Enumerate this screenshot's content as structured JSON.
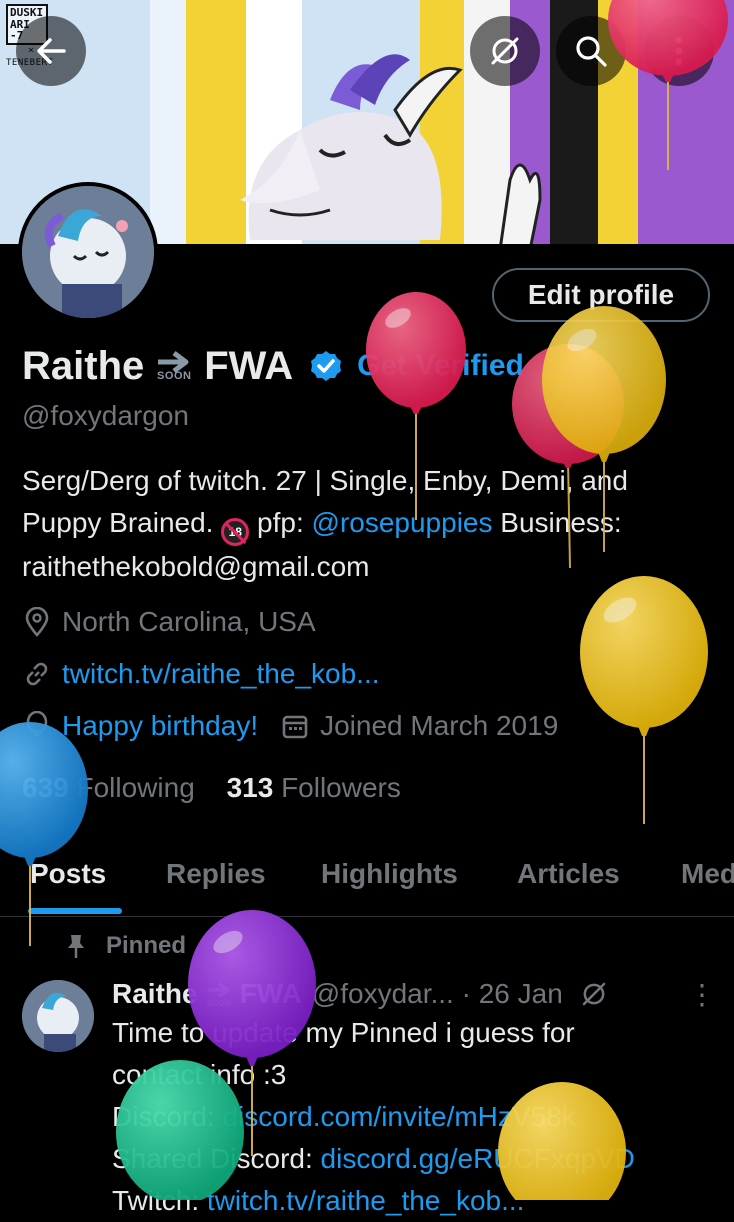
{
  "banner": {
    "artist_tag_lines": [
      "DUSKI",
      "ARI",
      "-7"
    ],
    "artist_collab": "TENEBERT",
    "back_icon": "arrow-left-icon",
    "top_icons": [
      "grok-slash-icon",
      "search-icon",
      "more-vertical-icon"
    ]
  },
  "profile": {
    "edit_label": "Edit profile",
    "name_left": "Raithe",
    "soon_label": "SOON",
    "name_right": "FWA",
    "get_verified": "Get Verified",
    "handle": "@foxydargon",
    "bio_line1": "Serg/Derg of twitch. 27 | Single, Enby, Demi, and",
    "bio_line2_prefix": "Puppy Brained.",
    "bio_no18": "18",
    "bio_line2_mid": "pfp:",
    "bio_mention": "@rosepuppies",
    "bio_line2_suffix": "Business:",
    "bio_line3": "raithethekobold@gmail.com",
    "location": "North Carolina, USA",
    "website": "twitch.tv/raithe_the_kob...",
    "birthday": "Happy birthday!",
    "joined": "Joined March 2019",
    "following_count": "639",
    "following_label": "Following",
    "followers_count": "313",
    "followers_label": "Followers"
  },
  "tabs": [
    "Posts",
    "Replies",
    "Highlights",
    "Articles",
    "Med"
  ],
  "pinned": {
    "label": "Pinned",
    "name_left": "Raithe",
    "soon_label": "SOON",
    "name_right": "FWA",
    "handle_time": "@foxydar... · 26 Jan",
    "more": "⋮",
    "line1": "Time to update my Pinned i guess for",
    "line2": "contact info :3",
    "line3_prefix": "Discord:",
    "line3_link": "discord.com/invite/mHzV58k",
    "line4_prefix": "Shared Discord:",
    "line4_link": "discord.gg/eRUCFxqpVD",
    "line5_prefix": "Twitch:",
    "line5_link": "twitch.tv/raithe_the_kob..."
  },
  "colors": {
    "accent": "#1d9bf0",
    "text": "#e7e9ea",
    "muted": "#71767b",
    "balloon_red": "#e0245e",
    "balloon_yellow": "#f5c518",
    "balloon_blue": "#1d9bf0",
    "balloon_purple": "#8b2fd6",
    "balloon_green": "#17bf8f"
  }
}
